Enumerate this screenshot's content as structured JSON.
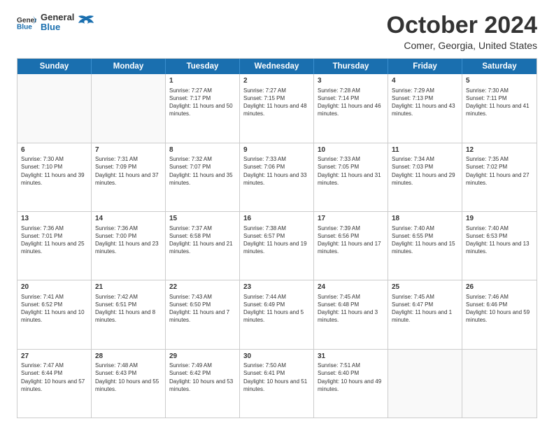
{
  "header": {
    "logo_general": "General",
    "logo_blue": "Blue",
    "month": "October 2024",
    "location": "Comer, Georgia, United States"
  },
  "days_of_week": [
    "Sunday",
    "Monday",
    "Tuesday",
    "Wednesday",
    "Thursday",
    "Friday",
    "Saturday"
  ],
  "weeks": [
    [
      {
        "day": "",
        "empty": true
      },
      {
        "day": "",
        "empty": true
      },
      {
        "day": "1",
        "sunrise": "Sunrise: 7:27 AM",
        "sunset": "Sunset: 7:17 PM",
        "daylight": "Daylight: 11 hours and 50 minutes."
      },
      {
        "day": "2",
        "sunrise": "Sunrise: 7:27 AM",
        "sunset": "Sunset: 7:15 PM",
        "daylight": "Daylight: 11 hours and 48 minutes."
      },
      {
        "day": "3",
        "sunrise": "Sunrise: 7:28 AM",
        "sunset": "Sunset: 7:14 PM",
        "daylight": "Daylight: 11 hours and 46 minutes."
      },
      {
        "day": "4",
        "sunrise": "Sunrise: 7:29 AM",
        "sunset": "Sunset: 7:13 PM",
        "daylight": "Daylight: 11 hours and 43 minutes."
      },
      {
        "day": "5",
        "sunrise": "Sunrise: 7:30 AM",
        "sunset": "Sunset: 7:11 PM",
        "daylight": "Daylight: 11 hours and 41 minutes."
      }
    ],
    [
      {
        "day": "6",
        "sunrise": "Sunrise: 7:30 AM",
        "sunset": "Sunset: 7:10 PM",
        "daylight": "Daylight: 11 hours and 39 minutes."
      },
      {
        "day": "7",
        "sunrise": "Sunrise: 7:31 AM",
        "sunset": "Sunset: 7:09 PM",
        "daylight": "Daylight: 11 hours and 37 minutes."
      },
      {
        "day": "8",
        "sunrise": "Sunrise: 7:32 AM",
        "sunset": "Sunset: 7:07 PM",
        "daylight": "Daylight: 11 hours and 35 minutes."
      },
      {
        "day": "9",
        "sunrise": "Sunrise: 7:33 AM",
        "sunset": "Sunset: 7:06 PM",
        "daylight": "Daylight: 11 hours and 33 minutes."
      },
      {
        "day": "10",
        "sunrise": "Sunrise: 7:33 AM",
        "sunset": "Sunset: 7:05 PM",
        "daylight": "Daylight: 11 hours and 31 minutes."
      },
      {
        "day": "11",
        "sunrise": "Sunrise: 7:34 AM",
        "sunset": "Sunset: 7:03 PM",
        "daylight": "Daylight: 11 hours and 29 minutes."
      },
      {
        "day": "12",
        "sunrise": "Sunrise: 7:35 AM",
        "sunset": "Sunset: 7:02 PM",
        "daylight": "Daylight: 11 hours and 27 minutes."
      }
    ],
    [
      {
        "day": "13",
        "sunrise": "Sunrise: 7:36 AM",
        "sunset": "Sunset: 7:01 PM",
        "daylight": "Daylight: 11 hours and 25 minutes."
      },
      {
        "day": "14",
        "sunrise": "Sunrise: 7:36 AM",
        "sunset": "Sunset: 7:00 PM",
        "daylight": "Daylight: 11 hours and 23 minutes."
      },
      {
        "day": "15",
        "sunrise": "Sunrise: 7:37 AM",
        "sunset": "Sunset: 6:58 PM",
        "daylight": "Daylight: 11 hours and 21 minutes."
      },
      {
        "day": "16",
        "sunrise": "Sunrise: 7:38 AM",
        "sunset": "Sunset: 6:57 PM",
        "daylight": "Daylight: 11 hours and 19 minutes."
      },
      {
        "day": "17",
        "sunrise": "Sunrise: 7:39 AM",
        "sunset": "Sunset: 6:56 PM",
        "daylight": "Daylight: 11 hours and 17 minutes."
      },
      {
        "day": "18",
        "sunrise": "Sunrise: 7:40 AM",
        "sunset": "Sunset: 6:55 PM",
        "daylight": "Daylight: 11 hours and 15 minutes."
      },
      {
        "day": "19",
        "sunrise": "Sunrise: 7:40 AM",
        "sunset": "Sunset: 6:53 PM",
        "daylight": "Daylight: 11 hours and 13 minutes."
      }
    ],
    [
      {
        "day": "20",
        "sunrise": "Sunrise: 7:41 AM",
        "sunset": "Sunset: 6:52 PM",
        "daylight": "Daylight: 11 hours and 10 minutes."
      },
      {
        "day": "21",
        "sunrise": "Sunrise: 7:42 AM",
        "sunset": "Sunset: 6:51 PM",
        "daylight": "Daylight: 11 hours and 8 minutes."
      },
      {
        "day": "22",
        "sunrise": "Sunrise: 7:43 AM",
        "sunset": "Sunset: 6:50 PM",
        "daylight": "Daylight: 11 hours and 7 minutes."
      },
      {
        "day": "23",
        "sunrise": "Sunrise: 7:44 AM",
        "sunset": "Sunset: 6:49 PM",
        "daylight": "Daylight: 11 hours and 5 minutes."
      },
      {
        "day": "24",
        "sunrise": "Sunrise: 7:45 AM",
        "sunset": "Sunset: 6:48 PM",
        "daylight": "Daylight: 11 hours and 3 minutes."
      },
      {
        "day": "25",
        "sunrise": "Sunrise: 7:45 AM",
        "sunset": "Sunset: 6:47 PM",
        "daylight": "Daylight: 11 hours and 1 minute."
      },
      {
        "day": "26",
        "sunrise": "Sunrise: 7:46 AM",
        "sunset": "Sunset: 6:46 PM",
        "daylight": "Daylight: 10 hours and 59 minutes."
      }
    ],
    [
      {
        "day": "27",
        "sunrise": "Sunrise: 7:47 AM",
        "sunset": "Sunset: 6:44 PM",
        "daylight": "Daylight: 10 hours and 57 minutes."
      },
      {
        "day": "28",
        "sunrise": "Sunrise: 7:48 AM",
        "sunset": "Sunset: 6:43 PM",
        "daylight": "Daylight: 10 hours and 55 minutes."
      },
      {
        "day": "29",
        "sunrise": "Sunrise: 7:49 AM",
        "sunset": "Sunset: 6:42 PM",
        "daylight": "Daylight: 10 hours and 53 minutes."
      },
      {
        "day": "30",
        "sunrise": "Sunrise: 7:50 AM",
        "sunset": "Sunset: 6:41 PM",
        "daylight": "Daylight: 10 hours and 51 minutes."
      },
      {
        "day": "31",
        "sunrise": "Sunrise: 7:51 AM",
        "sunset": "Sunset: 6:40 PM",
        "daylight": "Daylight: 10 hours and 49 minutes."
      },
      {
        "day": "",
        "empty": true
      },
      {
        "day": "",
        "empty": true
      }
    ]
  ]
}
